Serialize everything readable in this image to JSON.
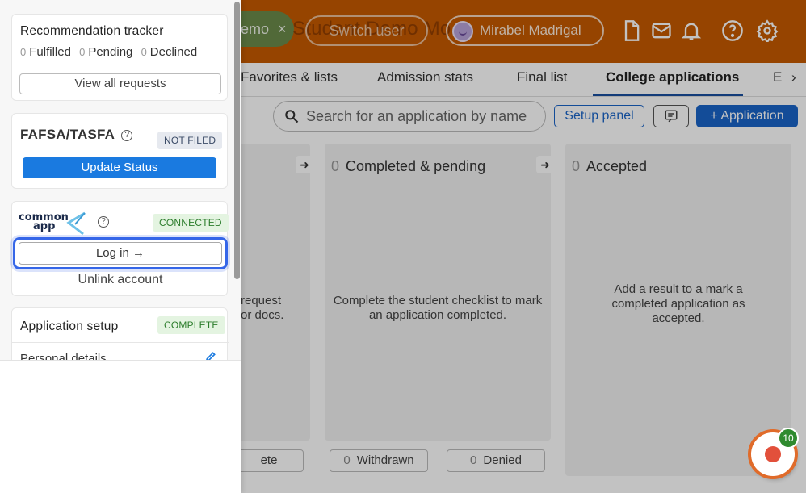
{
  "topbar": {
    "demo_label": "emo",
    "demo_close": "×",
    "student_title": "Student Demo Mo",
    "switch_label": "Switch user",
    "user_name": "Mirabel Madrigal",
    "icons": [
      "document-icon",
      "mail-icon",
      "bell-icon",
      "help-icon",
      "gear-icon"
    ],
    "color": "#c55a00"
  },
  "tabs": [
    {
      "label": "Favorites & lists",
      "active": false
    },
    {
      "label": "Admission stats",
      "active": false
    },
    {
      "label": "Final list",
      "active": false
    },
    {
      "label": "College applications",
      "active": true
    },
    {
      "label": "E",
      "active": false
    }
  ],
  "tabs_more": "›",
  "toolbar": {
    "search_placeholder": "Search for an application by name",
    "setup_label": "Setup panel",
    "add_label": "+ Application"
  },
  "board": {
    "col1": {
      "msg_line1": "request",
      "msg_line2": "or docs."
    },
    "col2": {
      "count": "0",
      "title": "Completed & pending",
      "msg": "Complete the student checklist to mark an application completed."
    },
    "col3": {
      "count": "0",
      "title": "Accepted",
      "msg": "Add a result to a mark a completed application as accepted."
    },
    "arrow": "➜",
    "filters": [
      {
        "count": "",
        "label": "ete"
      },
      {
        "count": "0",
        "label": "Withdrawn"
      },
      {
        "count": "0",
        "label": "Denied"
      }
    ]
  },
  "chat": {
    "badge": "10"
  },
  "panel": {
    "rec": {
      "title": "Recommendation tracker",
      "fulfilled_count": "0",
      "fulfilled_label": "Fulfilled",
      "pending_count": "0",
      "pending_label": "Pending",
      "declined_count": "0",
      "declined_label": "Declined",
      "view_all": "View all requests"
    },
    "fafsa": {
      "title": "FAFSA/TASFA",
      "help": "?",
      "status": "NOT FILED",
      "button": "Update Status"
    },
    "commonapp": {
      "logo_line1": "common",
      "logo_line2": "app",
      "help": "?",
      "status": "CONNECTED",
      "login": "Log in →",
      "unlink": "Unlink account"
    },
    "setup": {
      "title": "Application setup",
      "status": "COMPLETE",
      "personal": "Personal details"
    }
  },
  "colors": {
    "primary": "#1a7ae0",
    "focus_ring": "#3566e8",
    "badge_green": "#2c7d2c"
  }
}
